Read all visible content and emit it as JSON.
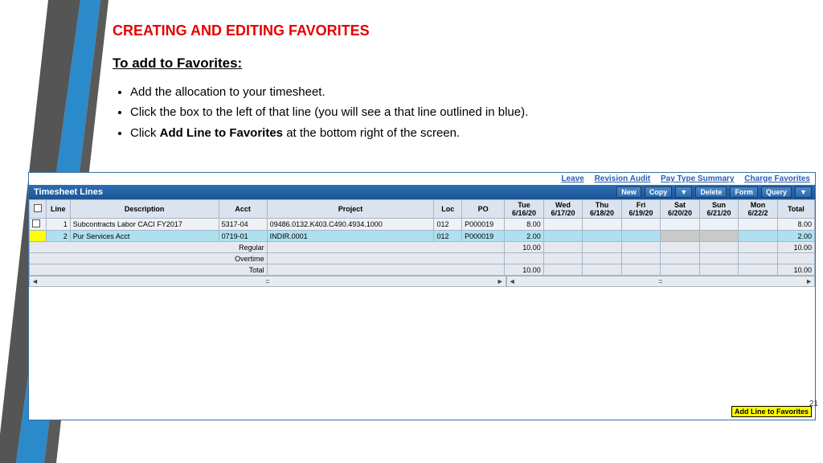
{
  "slide": {
    "title": "CREATING AND EDITING FAVORITES",
    "subtitle": "To add to Favorites:",
    "bullets": {
      "b1": "Add the allocation to your timesheet.",
      "b2": "Click the box to the left of that line (you will see a that line outlined in blue).",
      "b3_a": "Click ",
      "b3_bold": "Add Line to Favorites",
      "b3_b": " at the bottom right of the screen."
    },
    "page": "21"
  },
  "toplinks": {
    "leave": "Leave",
    "audit": "Revision Audit",
    "pts": "Pay Type Summary",
    "chfav": "Charge Favorites"
  },
  "headerbar": {
    "title": "Timesheet Lines",
    "btns": {
      "new": "New",
      "copy": "Copy",
      "dd1": "▼",
      "delete": "Delete",
      "form": "Form",
      "query": "Query",
      "dd2": "▼"
    }
  },
  "cols": {
    "chk": "",
    "line": "Line",
    "desc": "Description",
    "acct": "Acct",
    "project": "Project",
    "loc": "Loc",
    "po": "PO",
    "d1": "Tue",
    "d1s": "6/16/20",
    "d2": "Wed",
    "d2s": "6/17/20",
    "d3": "Thu",
    "d3s": "6/18/20",
    "d4": "Fri",
    "d4s": "6/19/20",
    "d5": "Sat",
    "d5s": "6/20/20",
    "d6": "Sun",
    "d6s": "6/21/20",
    "d7": "Mon",
    "d7s": "6/22/2",
    "total": "Total"
  },
  "rows": [
    {
      "line": "1",
      "desc": "Subcontracts Labor CACI FY2017",
      "acct": "5317-04",
      "project": "09486.0132.K403.C490.4934.1000",
      "loc": "012",
      "po": "P000019",
      "d1": "8.00",
      "d2": "",
      "d3": "",
      "d4": "",
      "d5": "",
      "d6": "",
      "d7": "",
      "total": "8.00"
    },
    {
      "line": "2",
      "desc": "Pur Services Acct",
      "acct": "0719-01",
      "project": "INDIR.0001",
      "loc": "012",
      "po": "P000019",
      "d1": "2.00",
      "d2": "",
      "d3": "",
      "d4": "",
      "d5": "",
      "d6": "",
      "d7": "",
      "total": "2.00"
    }
  ],
  "summary": {
    "regular": "Regular",
    "regular_v": "10.00",
    "overtime": "Overtime",
    "overtime_v": "",
    "total": "Total",
    "total_v": "10.00",
    "grand_reg": "10.00",
    "grand_tot": "10.00"
  },
  "addfav": "Add Line to Favorites"
}
